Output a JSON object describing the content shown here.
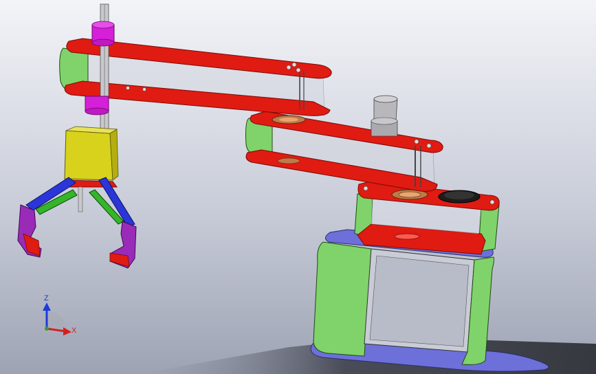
{
  "triad": {
    "z_label": "Z",
    "x_label": "X",
    "z_color": "#1f3bd6",
    "x_color": "#d62020"
  },
  "colors": {
    "arm_red": "#e01b12",
    "arm_edge": "#7a0a06",
    "green": "#7fd36a",
    "magenta": "#d61fd8",
    "gripper_yellow": "#d8d21c",
    "jaw_blue": "#2a36d8",
    "jaw_green": "#35b52a",
    "finger_purple": "#9a2bb8",
    "base_plate_blue": "#6d70d8",
    "glass_gray": "#c9ccd6",
    "motor_gray": "#b8b8bc"
  }
}
